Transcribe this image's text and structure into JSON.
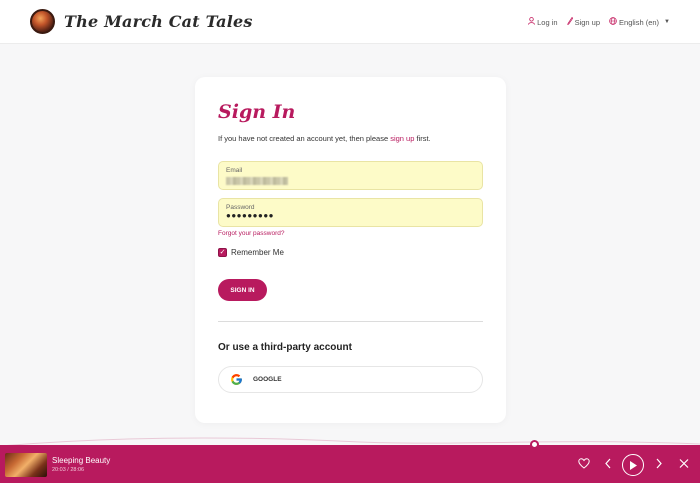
{
  "header": {
    "site_title": "The March Cat Tales",
    "nav": {
      "login": "Log in",
      "signup": "Sign up",
      "language": "English (en)"
    }
  },
  "signin": {
    "title": "Sign In",
    "intro_before": "If you have not created an account yet, then please ",
    "intro_link": "sign up",
    "intro_after": " first.",
    "email_label": "Email",
    "password_label": "Password",
    "password_value": "●●●●●●●●●",
    "forgot": "Forgot your password?",
    "remember": "Remember Me",
    "remember_checked": true,
    "submit": "SIGN IN",
    "third_party_title": "Or use a third-party account",
    "google": "GOOGLE"
  },
  "player": {
    "title": "Sleeping Beauty",
    "time": "20:03 / 28:06",
    "progress": 0.713
  },
  "colors": {
    "accent": "#b81a5e",
    "autofill": "#fdfbc8"
  },
  "icons": [
    "user-icon",
    "pen-icon",
    "globe-icon",
    "google-icon",
    "heart-icon",
    "prev-icon",
    "play-icon",
    "next-icon",
    "close-icon"
  ]
}
